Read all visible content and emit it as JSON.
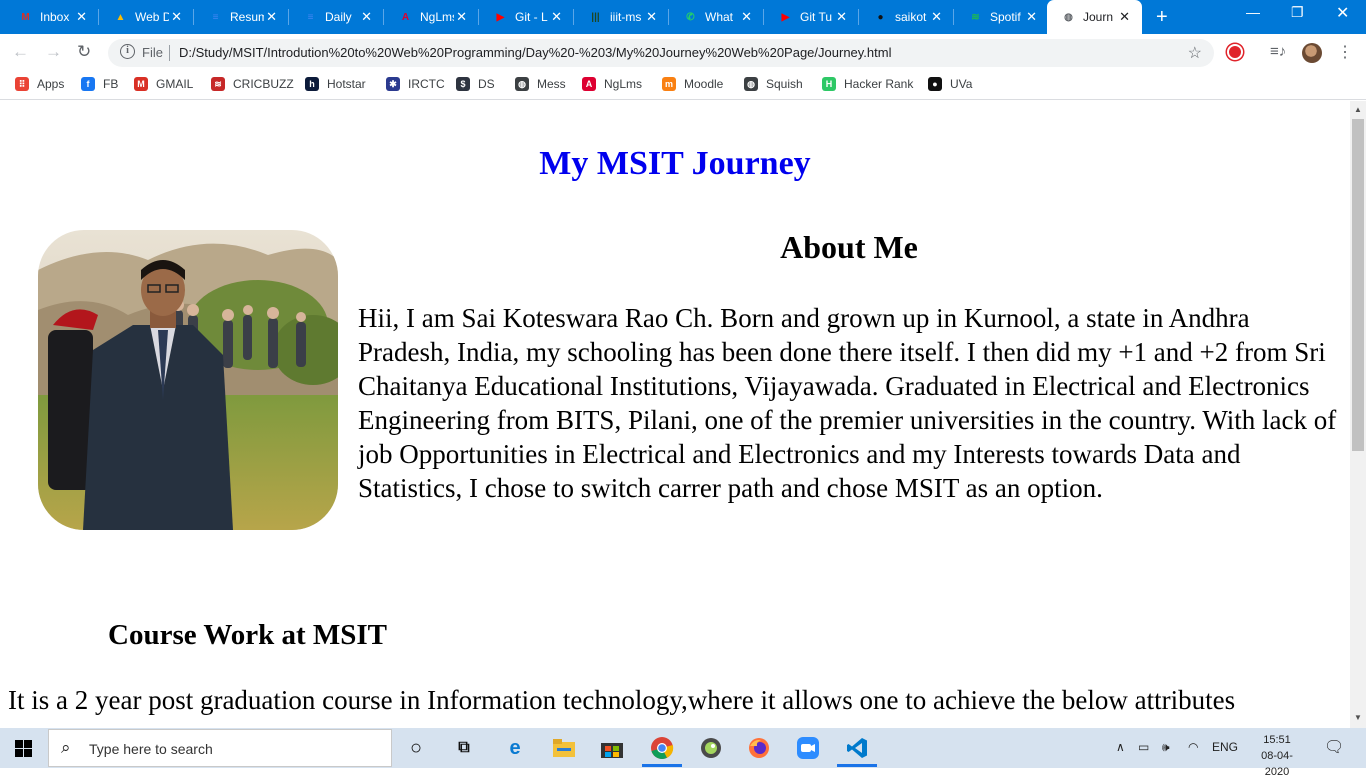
{
  "browser": {
    "tabs": [
      {
        "title": "Inbox",
        "icon": "gmail-icon",
        "color": "#d93025",
        "glyph": "M"
      },
      {
        "title": "Web D",
        "icon": "drive-icon",
        "color": "#fbbc04",
        "glyph": "▲"
      },
      {
        "title": "Resum",
        "icon": "docs-icon",
        "color": "#4285f4",
        "glyph": "≡"
      },
      {
        "title": "Daily",
        "icon": "docs-icon",
        "color": "#4285f4",
        "glyph": "≡"
      },
      {
        "title": "NgLms",
        "icon": "angular-icon",
        "color": "#dd0031",
        "glyph": "A"
      },
      {
        "title": "Git - L",
        "icon": "youtube-icon",
        "color": "#ff0000",
        "glyph": "▶"
      },
      {
        "title": "iiit-ms",
        "icon": "site-icon",
        "color": "#1e4620",
        "glyph": "|||"
      },
      {
        "title": "What",
        "icon": "whatsapp-icon",
        "color": "#25d366",
        "glyph": "✆"
      },
      {
        "title": "Git Tu",
        "icon": "youtube-icon",
        "color": "#ff0000",
        "glyph": "▶"
      },
      {
        "title": "saikot",
        "icon": "github-icon",
        "color": "#111111",
        "glyph": "●"
      },
      {
        "title": "Spotif",
        "icon": "spotify-icon",
        "color": "#1db954",
        "glyph": "≋"
      },
      {
        "title": "Journ",
        "icon": "globe-icon",
        "color": "#5f6368",
        "glyph": "◍",
        "active": true
      }
    ],
    "address": {
      "scheme": "File",
      "url": "D:/Study/MSIT/Introdution%20to%20Web%20Programming/Day%20-%203/My%20Journey%20Web%20Page/Journey.html"
    },
    "bookmarks": [
      {
        "label": "Apps",
        "icon": "apps-grid-icon",
        "color": "#ea4335",
        "glyph": "⠿"
      },
      {
        "label": "FB",
        "icon": "facebook-icon",
        "color": "#1877f2",
        "glyph": "f"
      },
      {
        "label": "GMAIL",
        "icon": "gmail-icon",
        "color": "#d93025",
        "glyph": "M"
      },
      {
        "label": "CRICBUZZ",
        "icon": "cricbuzz-icon",
        "color": "#c62828",
        "glyph": "≋"
      },
      {
        "label": "Hotstar",
        "icon": "hotstar-icon",
        "color": "#0c1b3a",
        "glyph": "h"
      },
      {
        "label": "IRCTC",
        "icon": "irctc-icon",
        "color": "#2b3a8f",
        "glyph": "✱"
      },
      {
        "label": "DS",
        "icon": "ds-icon",
        "color": "#2e3440",
        "glyph": "$"
      },
      {
        "label": "Mess",
        "icon": "globe-icon",
        "color": "#3c4043",
        "glyph": "◍"
      },
      {
        "label": "NgLms",
        "icon": "angular-icon",
        "color": "#dd0031",
        "glyph": "A"
      },
      {
        "label": "Moodle",
        "icon": "moodle-icon",
        "color": "#f98012",
        "glyph": "m"
      },
      {
        "label": "Squish",
        "icon": "globe-icon",
        "color": "#3c4043",
        "glyph": "◍"
      },
      {
        "label": "Hacker Rank",
        "icon": "hackerrank-icon",
        "color": "#2ec866",
        "glyph": "H"
      },
      {
        "label": "UVa",
        "icon": "github-icon",
        "color": "#111111",
        "glyph": "●"
      }
    ]
  },
  "page": {
    "heading": "My MSIT Journey",
    "about_title": "About Me",
    "about_text": "Hii, I am Sai Koteswara Rao Ch. Born and grown up in Kurnool, a state in Andhra Pradesh, India, my schooling has been done there itself. I then did my +1 and +2 from Sri Chaitanya Educational Institutions, Vijayawada. Graduated in Electrical and Electronics Engineering from BITS, Pilani, one of the premier universities in the country. With lack of job Opportunities in Electrical and Electronics and my Interests towards Data and Statistics, I chose to switch carrer path and chose MSIT as an option.",
    "course_title": "Course Work at MSIT",
    "course_text": "It is a 2 year post graduation course in Information technology,where it allows one to achieve the below attributes"
  },
  "taskbar": {
    "search_placeholder": "Type here to search",
    "tray_lang": "ENG",
    "time": "15:51",
    "date": "08-04-2020"
  }
}
